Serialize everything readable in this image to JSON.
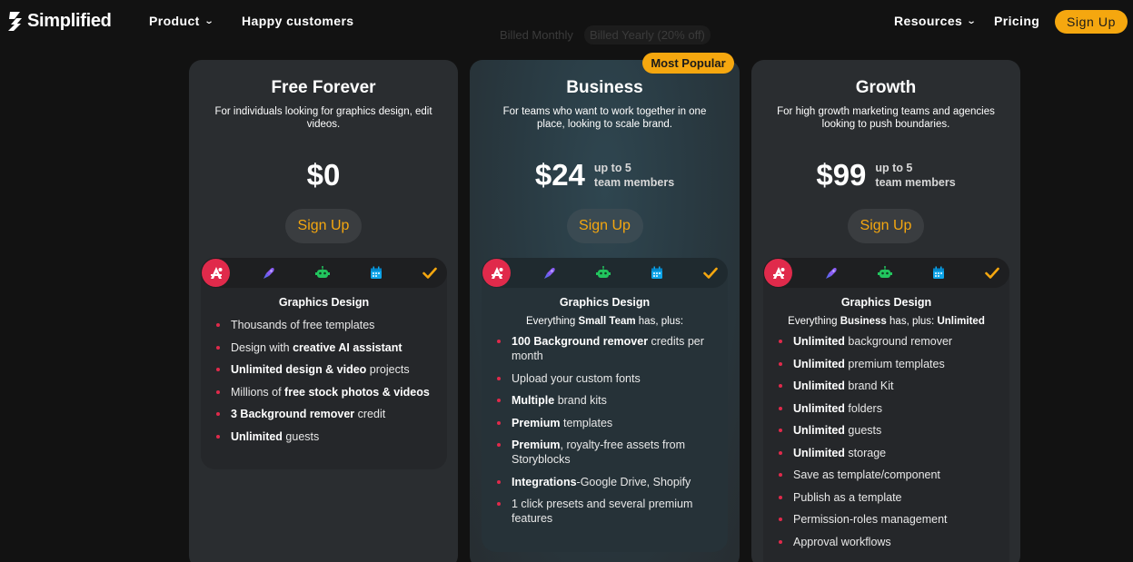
{
  "nav": {
    "brand": "Simplified",
    "product": "Product",
    "happy_customers": "Happy customers",
    "resources": "Resources",
    "pricing": "Pricing",
    "signup": "Sign Up"
  },
  "billing": {
    "monthly": "Billed Monthly",
    "yearly": "Billed Yearly (20% off)"
  },
  "badge": "Most Popular",
  "colors": {
    "accent": "#f5a70f",
    "active_icon": "#e02a4b"
  },
  "category_icons": [
    "graphics-design-icon",
    "rocket-icon",
    "robot-icon",
    "calendar-icon",
    "checkmark-icon"
  ],
  "plans": [
    {
      "title": "Free Forever",
      "description": "For individuals looking for graphics design, edit videos.",
      "price": "$0",
      "price_note_1": "",
      "price_note_2": "",
      "signup": "Sign Up",
      "section_title": "Graphics Design",
      "section_sub_parts": [],
      "features": [
        [
          {
            "t": "Thousands of free templates"
          }
        ],
        [
          {
            "t": "Design with "
          },
          {
            "t": "creative AI assistant",
            "b": true
          }
        ],
        [
          {
            "t": "Unlimited design & video",
            "b": true
          },
          {
            "t": " projects"
          }
        ],
        [
          {
            "t": "Millions of "
          },
          {
            "t": "free stock photos & videos",
            "b": true
          }
        ],
        [
          {
            "t": "3 Background remover",
            "b": true
          },
          {
            "t": " credit"
          }
        ],
        [
          {
            "t": "Unlimited",
            "b": true
          },
          {
            "t": " guests"
          }
        ]
      ]
    },
    {
      "title": "Business",
      "description": "For teams who want to work together in one place, looking to scale brand.",
      "price": "$24",
      "price_note_1": "up to 5",
      "price_note_2": "team members",
      "signup": "Sign Up",
      "section_title": "Graphics Design",
      "section_sub_parts": [
        {
          "t": "Everything "
        },
        {
          "t": "Small Team",
          "b": true
        },
        {
          "t": " has, plus:"
        }
      ],
      "features": [
        [
          {
            "t": "100 Background remover",
            "b": true
          },
          {
            "t": " credits per month"
          }
        ],
        [
          {
            "t": "Upload your custom fonts"
          }
        ],
        [
          {
            "t": "Multiple",
            "b": true
          },
          {
            "t": " brand kits"
          }
        ],
        [
          {
            "t": "Premium",
            "b": true
          },
          {
            "t": " templates"
          }
        ],
        [
          {
            "t": "Premium",
            "b": true
          },
          {
            "t": ", royalty-free assets from Storyblocks"
          }
        ],
        [
          {
            "t": "Integrations",
            "b": true
          },
          {
            "t": "-Google Drive, Shopify"
          }
        ],
        [
          {
            "t": "1 click presets and several premium features"
          }
        ]
      ]
    },
    {
      "title": "Growth",
      "description": "For high growth marketing teams and agencies looking to push boundaries.",
      "price": "$99",
      "price_note_1": "up to 5",
      "price_note_2": "team members",
      "signup": "Sign Up",
      "section_title": "Graphics Design",
      "section_sub_parts": [
        {
          "t": "Everything "
        },
        {
          "t": "Business",
          "b": true
        },
        {
          "t": " has, plus: "
        },
        {
          "t": "Unlimited",
          "b": true
        }
      ],
      "features": [
        [
          {
            "t": "Unlimited",
            "b": true
          },
          {
            "t": " background remover"
          }
        ],
        [
          {
            "t": "Unlimited",
            "b": true
          },
          {
            "t": " premium templates"
          }
        ],
        [
          {
            "t": "Unlimited",
            "b": true
          },
          {
            "t": " brand Kit"
          }
        ],
        [
          {
            "t": "Unlimited",
            "b": true
          },
          {
            "t": " folders"
          }
        ],
        [
          {
            "t": "Unlimited",
            "b": true
          },
          {
            "t": " guests"
          }
        ],
        [
          {
            "t": "Unlimited",
            "b": true
          },
          {
            "t": " storage"
          }
        ],
        [
          {
            "t": "Save as template/component"
          }
        ],
        [
          {
            "t": "Publish as a template"
          }
        ],
        [
          {
            "t": "Permission-roles management"
          }
        ],
        [
          {
            "t": "Approval workflows"
          }
        ]
      ]
    }
  ]
}
